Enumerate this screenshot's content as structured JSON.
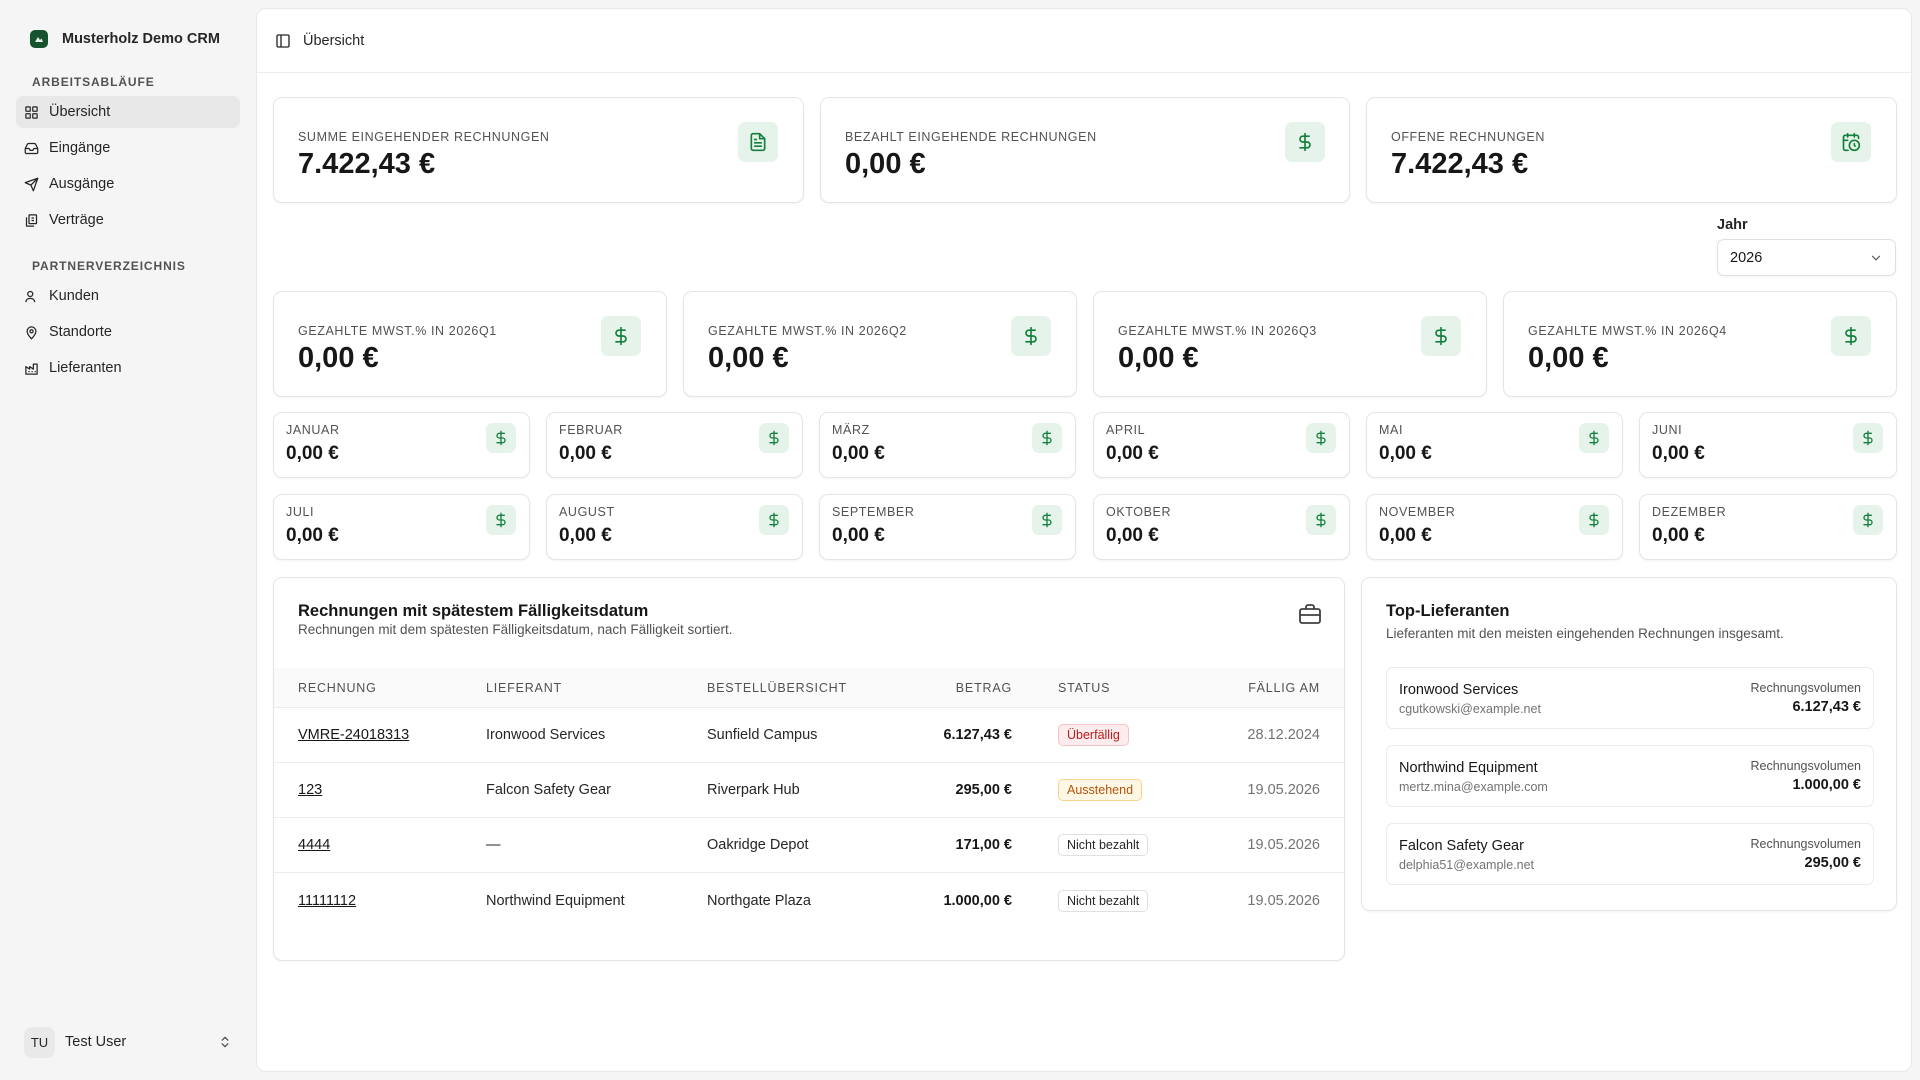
{
  "app": {
    "name": "Musterholz Demo CRM"
  },
  "sidebar": {
    "groups": [
      {
        "label": "ARBEITSABLÄUFE",
        "items": [
          {
            "label": "Übersicht",
            "icon": "grid-icon",
            "active": true
          },
          {
            "label": "Eingänge",
            "icon": "inbox-icon"
          },
          {
            "label": "Ausgänge",
            "icon": "send-icon"
          },
          {
            "label": "Verträge",
            "icon": "contracts-icon"
          }
        ]
      },
      {
        "label": "PARTNERVERZEICHNIS",
        "items": [
          {
            "label": "Kunden",
            "icon": "users-icon"
          },
          {
            "label": "Standorte",
            "icon": "map-pin-icon"
          },
          {
            "label": "Lieferanten",
            "icon": "factory-icon"
          }
        ]
      }
    ],
    "user": {
      "initials": "TU",
      "name": "Test User"
    }
  },
  "header": {
    "title": "Übersicht"
  },
  "kpis": [
    {
      "label": "SUMME EINGEHENDER RECHNUNGEN",
      "value": "7.422,43 €",
      "icon": "file-text-icon"
    },
    {
      "label": "BEZAHLT EINGEHENDE RECHNUNGEN",
      "value": "0,00 €",
      "icon": "dollar-icon"
    },
    {
      "label": "OFFENE RECHNUNGEN",
      "value": "7.422,43 €",
      "icon": "calendar-clock-icon"
    }
  ],
  "year": {
    "label": "Jahr",
    "value": "2026"
  },
  "quarters": [
    {
      "label": "GEZAHLTE MWST.% IN 2026Q1",
      "value": "0,00 €"
    },
    {
      "label": "GEZAHLTE MWST.% IN 2026Q2",
      "value": "0,00 €"
    },
    {
      "label": "GEZAHLTE MWST.% IN 2026Q3",
      "value": "0,00 €"
    },
    {
      "label": "GEZAHLTE MWST.% IN 2026Q4",
      "value": "0,00 €"
    }
  ],
  "months": [
    {
      "label": "JANUAR",
      "value": "0,00 €"
    },
    {
      "label": "FEBRUAR",
      "value": "0,00 €"
    },
    {
      "label": "MÄRZ",
      "value": "0,00 €"
    },
    {
      "label": "APRIL",
      "value": "0,00 €"
    },
    {
      "label": "MAI",
      "value": "0,00 €"
    },
    {
      "label": "JUNI",
      "value": "0,00 €"
    },
    {
      "label": "JULI",
      "value": "0,00 €"
    },
    {
      "label": "AUGUST",
      "value": "0,00 €"
    },
    {
      "label": "SEPTEMBER",
      "value": "0,00 €"
    },
    {
      "label": "OKTOBER",
      "value": "0,00 €"
    },
    {
      "label": "NOVEMBER",
      "value": "0,00 €"
    },
    {
      "label": "DEZEMBER",
      "value": "0,00 €"
    }
  ],
  "invoices": {
    "title": "Rechnungen mit spätestem Fälligkeitsdatum",
    "subtitle": "Rechnungen mit dem spätesten Fälligkeitsdatum, nach Fälligkeit sortiert.",
    "columns": [
      "RECHNUNG",
      "LIEFERANT",
      "BESTELLÜBERSICHT",
      "BETRAG",
      "STATUS",
      "FÄLLIG AM"
    ],
    "rows": [
      {
        "id": "VMRE-24018313",
        "supplier": "Ironwood Services",
        "order": "Sunfield Campus",
        "amount": "6.127,43 €",
        "status": "Überfällig",
        "status_type": "overdue",
        "due": "28.12.2024"
      },
      {
        "id": "123",
        "supplier": "Falcon Safety Gear",
        "order": "Riverpark Hub",
        "amount": "295,00 €",
        "status": "Ausstehend",
        "status_type": "pending",
        "due": "19.05.2026"
      },
      {
        "id": "4444",
        "supplier": "—",
        "order": "Oakridge Depot",
        "amount": "171,00 €",
        "status": "Nicht bezahlt",
        "status_type": "unpaid",
        "due": "19.05.2026"
      },
      {
        "id": "11111112",
        "supplier": "Northwind Equipment",
        "order": "Northgate Plaza",
        "amount": "1.000,00 €",
        "status": "Nicht bezahlt",
        "status_type": "unpaid",
        "due": "19.05.2026"
      }
    ]
  },
  "suppliers": {
    "title": "Top-Lieferanten",
    "subtitle": "Lieferanten mit den meisten eingehenden Rechnungen insgesamt.",
    "volume_label": "Rechnungsvolumen",
    "items": [
      {
        "name": "Ironwood Services",
        "email": "cgutkowski@example.net",
        "volume": "6.127,43 €"
      },
      {
        "name": "Northwind Equipment",
        "email": "mertz.mina@example.com",
        "volume": "1.000,00 €"
      },
      {
        "name": "Falcon Safety Gear",
        "email": "delphia51@example.net",
        "volume": "295,00 €"
      }
    ]
  },
  "colors": {
    "accent": "#15803d",
    "accent_bg": "#e6f3ea",
    "overdue": "#b91c1c",
    "pending": "#b45309"
  }
}
